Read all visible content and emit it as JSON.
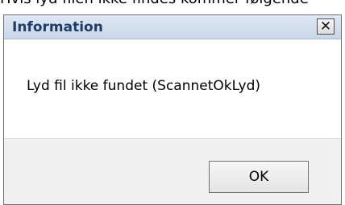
{
  "background_text": "Hvis lyd filen ikke findes kommer følgende",
  "dialog": {
    "title": "Information",
    "close_icon": "close-x-icon",
    "close_glyph": "✕",
    "message": "Lyd fil ikke fundet (ScannetOkLyd)",
    "ok_label": "OK"
  },
  "colors": {
    "titlebar_start": "#dfe8f3",
    "titlebar_end": "#c9d7ea",
    "title_text": "#1f3b66",
    "content_bg": "#ffffff",
    "footer_bg": "#f0f0f0"
  }
}
